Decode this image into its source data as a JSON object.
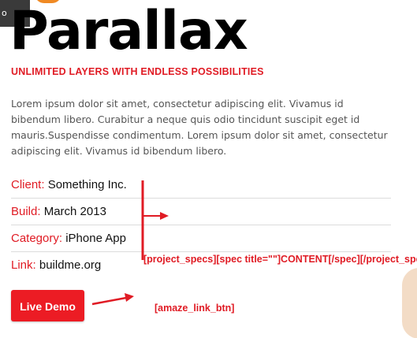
{
  "header": {
    "tab_label": "o",
    "title": "Parallax",
    "subtitle": "UNLIMITED LAYERS WITH ENDLESS POSSIBILITIES"
  },
  "description": "Lorem ipsum dolor sit amet, consectetur adipiscing elit. Vivamus id bibendum libero. Curabitur a neque quis odio tincidunt suscipit eget id mauris.Suspendisse condimentum. Lorem ipsum dolor sit amet, consectetur adipiscing elit. Vivamus id bibendum libero.",
  "specs": [
    {
      "label": "Client:",
      "value": "Something Inc."
    },
    {
      "label": "Build:",
      "value": "March 2013"
    },
    {
      "label": "Category:",
      "value": "iPhone App"
    },
    {
      "label": "Link:",
      "value": "buildme.org"
    }
  ],
  "live_demo_button": {
    "label": "Live Demo"
  },
  "annotations": {
    "specs_shortcode": "[project_specs][spec title=\"\"]CONTENT[/spec][/project_specs]",
    "link_btn_shortcode": "[amaze_link_btn]"
  },
  "colors": {
    "accent_red": "#e01b24",
    "button_red": "#ec1c24",
    "tab_dark": "#3a3a3a",
    "orange": "#f08a24"
  }
}
